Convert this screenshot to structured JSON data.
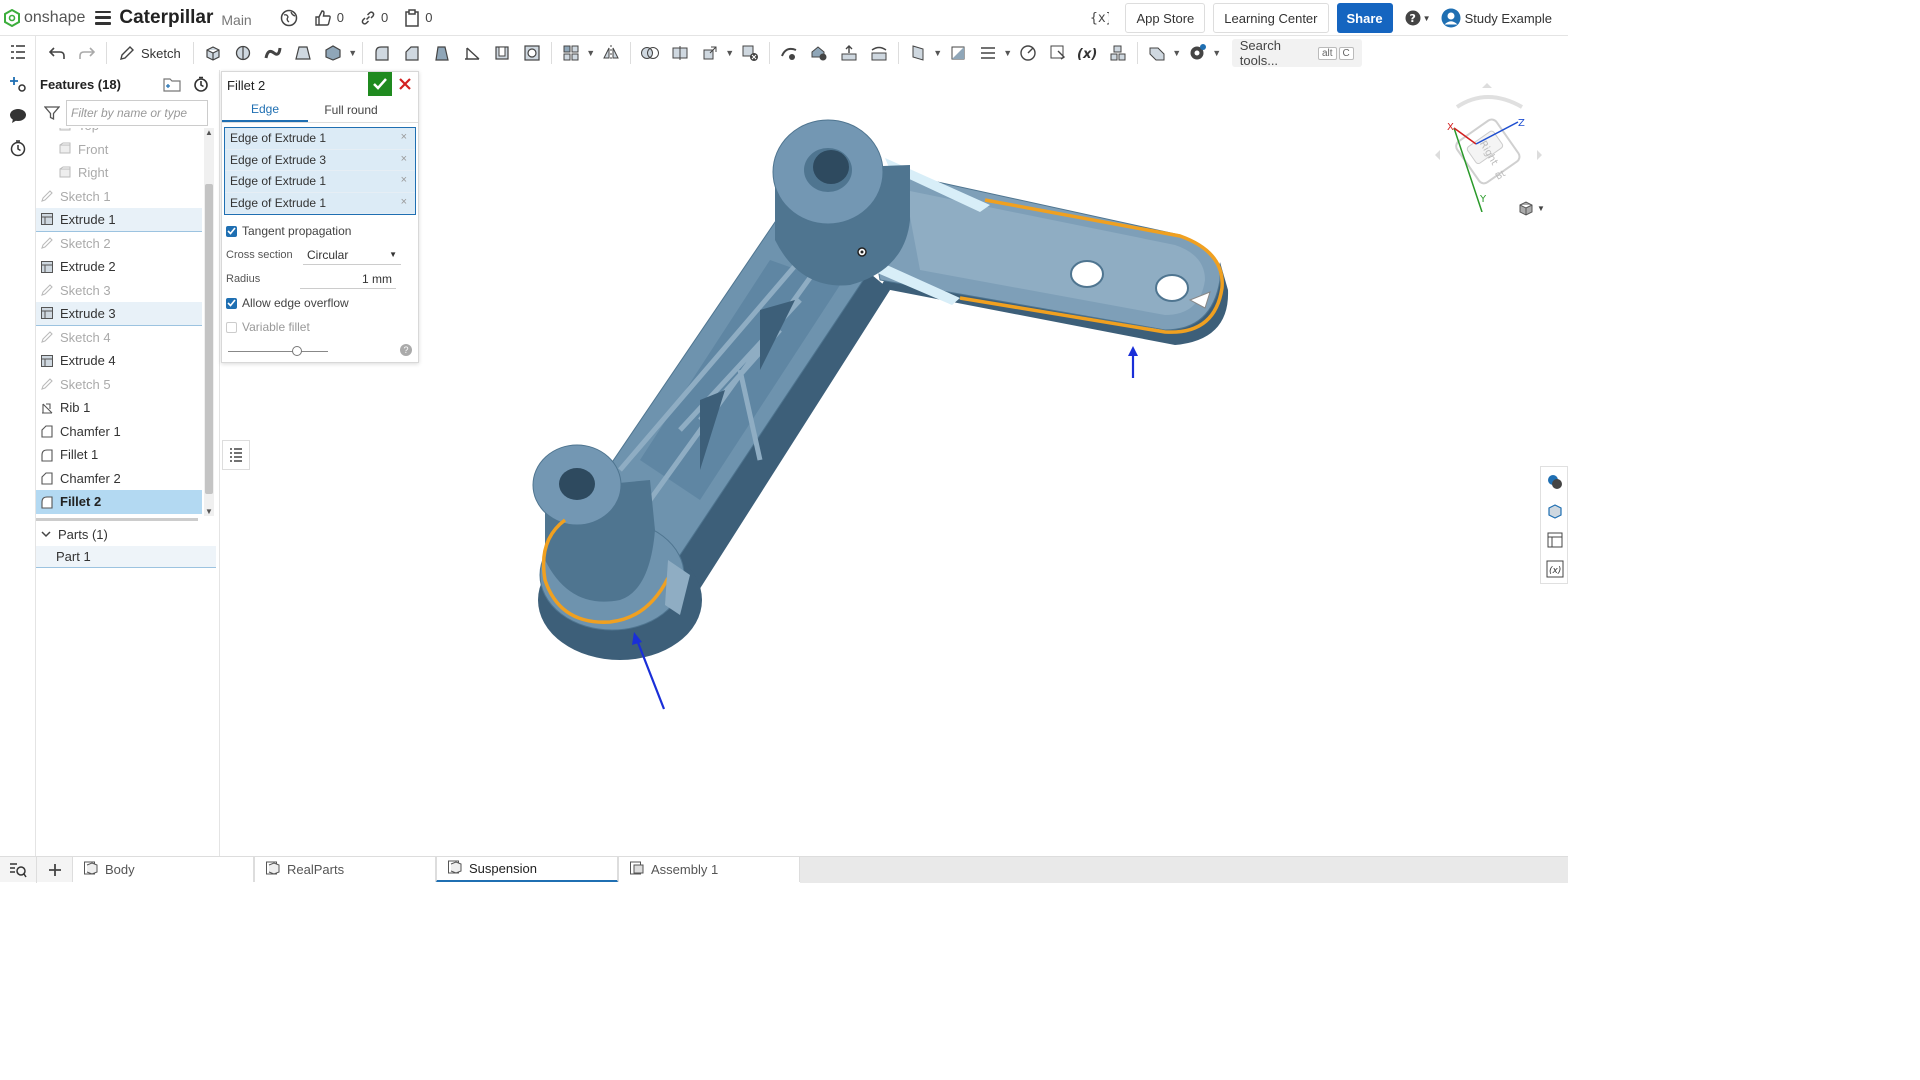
{
  "app": {
    "logo_text": "onshape",
    "doc_title": "Caterpillar",
    "branch": "Main"
  },
  "top_counts": {
    "likes": "0",
    "links": "0",
    "copies": "0"
  },
  "top_buttons": {
    "app_store": "App Store",
    "learning_center": "Learning Center",
    "share": "Share",
    "user": "Study Example"
  },
  "toolbar": {
    "sketch_label": "Sketch",
    "search_label": "Search tools...",
    "search_kbd_1": "alt",
    "search_kbd_2": "C"
  },
  "features": {
    "title": "Features (18)",
    "filter_placeholder": "Filter by name or type",
    "items": [
      {
        "label": "Top",
        "kind": "plane",
        "state": "dim"
      },
      {
        "label": "Front",
        "kind": "plane",
        "state": "dim"
      },
      {
        "label": "Right",
        "kind": "plane",
        "state": "dim"
      },
      {
        "label": "Sketch 1",
        "kind": "sketch",
        "state": "dim"
      },
      {
        "label": "Extrude 1",
        "kind": "extrude",
        "state": "highlight"
      },
      {
        "label": "Sketch 2",
        "kind": "sketch",
        "state": "dim"
      },
      {
        "label": "Extrude 2",
        "kind": "extrude",
        "state": "normal"
      },
      {
        "label": "Sketch 3",
        "kind": "sketch",
        "state": "dim"
      },
      {
        "label": "Extrude 3",
        "kind": "extrude",
        "state": "highlight"
      },
      {
        "label": "Sketch 4",
        "kind": "sketch",
        "state": "dim"
      },
      {
        "label": "Extrude 4",
        "kind": "extrude",
        "state": "normal"
      },
      {
        "label": "Sketch 5",
        "kind": "sketch",
        "state": "dim"
      },
      {
        "label": "Rib 1",
        "kind": "rib",
        "state": "normal"
      },
      {
        "label": "Chamfer 1",
        "kind": "chamfer",
        "state": "normal"
      },
      {
        "label": "Fillet 1",
        "kind": "fillet",
        "state": "normal"
      },
      {
        "label": "Chamfer 2",
        "kind": "chamfer",
        "state": "normal"
      },
      {
        "label": "Fillet 2",
        "kind": "fillet",
        "state": "selected"
      }
    ],
    "parts_header": "Parts (1)",
    "part_item": "Part 1"
  },
  "dialog": {
    "title": "Fillet 2",
    "tab_edge": "Edge",
    "tab_full_round": "Full round",
    "selections": [
      "Edge of Extrude 1",
      "Edge of Extrude 3",
      "Edge of Extrude 1",
      "Edge of Extrude 1"
    ],
    "tangent_propagation": "Tangent propagation",
    "cross_section_label": "Cross section",
    "cross_section_value": "Circular",
    "radius_label": "Radius",
    "radius_value": "1 mm",
    "allow_edge_overflow": "Allow edge overflow",
    "variable_fillet": "Variable fillet",
    "tangent_checked": true,
    "overflow_checked": true,
    "variable_checked": false
  },
  "viewcube": {
    "face_label": "Right",
    "axis_x": "X",
    "axis_y": "Y",
    "axis_z": "Z"
  },
  "bottom_tabs": [
    {
      "label": "Body",
      "active": false
    },
    {
      "label": "RealParts",
      "active": false
    },
    {
      "label": "Suspension",
      "active": true
    },
    {
      "label": "Assembly 1",
      "active": false
    }
  ],
  "colors": {
    "accent": "#1f6fb2",
    "share": "#1565c0",
    "ok": "#1f8a1f",
    "model": "#7397b3",
    "model_dark": "#4f7590",
    "highlight_edge": "#f0a020",
    "selection_bg": "#b3d9f2"
  }
}
